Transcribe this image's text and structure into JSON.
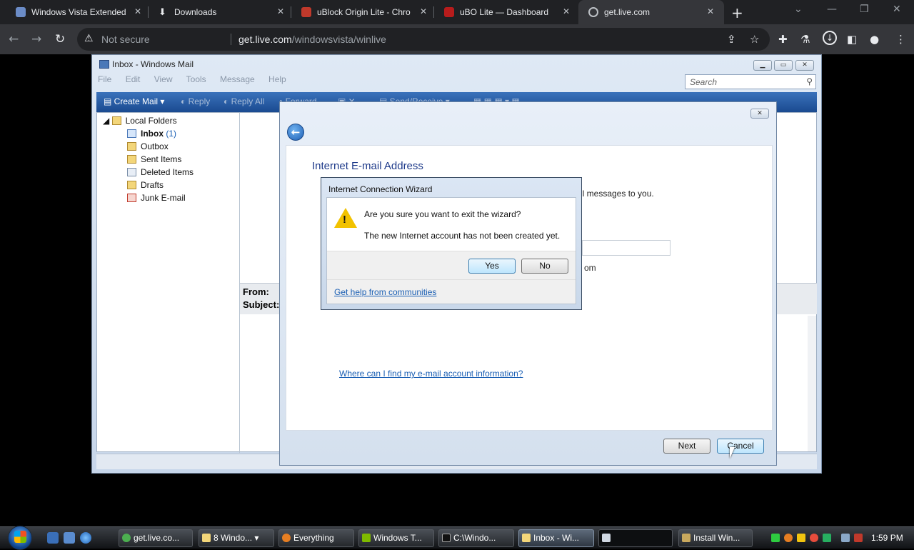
{
  "browser": {
    "tabs": [
      {
        "title": "Windows Vista Extended",
        "active": false
      },
      {
        "title": "Downloads",
        "active": false
      },
      {
        "title": "uBlock Origin Lite - Chro",
        "active": false
      },
      {
        "title": "uBO Lite — Dashboard",
        "active": false
      },
      {
        "title": "get.live.com",
        "active": true
      }
    ],
    "new_tab": "+",
    "security_label": "Not secure",
    "url_host": "get.live.com",
    "url_path": "/windowsvista/winlive"
  },
  "mail": {
    "window_title": "Inbox - Windows Mail",
    "menu": [
      "File",
      "Edit",
      "View",
      "Tools",
      "Message",
      "Help"
    ],
    "search_placeholder": "Search",
    "toolbar": {
      "create_mail": "Create Mail",
      "reply": "Reply",
      "reply_all": "Reply All",
      "forward": "Forward",
      "send_receive": "Send/Receive"
    },
    "folders": {
      "root": "Local Folders",
      "items": [
        {
          "name": "Inbox",
          "count": "(1)"
        },
        {
          "name": "Outbox"
        },
        {
          "name": "Sent Items"
        },
        {
          "name": "Deleted Items"
        },
        {
          "name": "Drafts"
        },
        {
          "name": "Junk E-mail"
        }
      ]
    },
    "reading_pane": {
      "from_label": "From:",
      "subject_label": "Subject:"
    }
  },
  "wizard": {
    "heading": "Internet E-mail Address",
    "description_fragment": "il messages to you.",
    "example_fragment": "om",
    "help_link": "Where can I find my e-mail account information?",
    "next": "Next",
    "cancel": "Cancel"
  },
  "confirm": {
    "title": "Internet Connection Wizard",
    "question": "Are you sure you want to exit the wizard?",
    "detail": "The new Internet account has not been created yet.",
    "yes": "Yes",
    "no": "No",
    "help": "Get help from communities"
  },
  "taskbar": {
    "buttons": [
      {
        "label": "get.live.co...",
        "active": false
      },
      {
        "label": "8 Windo...",
        "active": false
      },
      {
        "label": "Everything",
        "active": false
      },
      {
        "label": "Windows T...",
        "active": false
      },
      {
        "label": "C:\\Windo...",
        "active": false
      },
      {
        "label": "Inbox - Wi...",
        "active": true
      },
      {
        "label": "",
        "active": false
      },
      {
        "label": "Install Win...",
        "active": false
      }
    ],
    "clock": "1:59 PM"
  },
  "colors": {
    "chrome_bg": "#202124",
    "chrome_toolbar": "#35363a",
    "mail_toolbar": "#1a4a90",
    "link": "#1a5fb4",
    "warning": "#f2c200"
  }
}
